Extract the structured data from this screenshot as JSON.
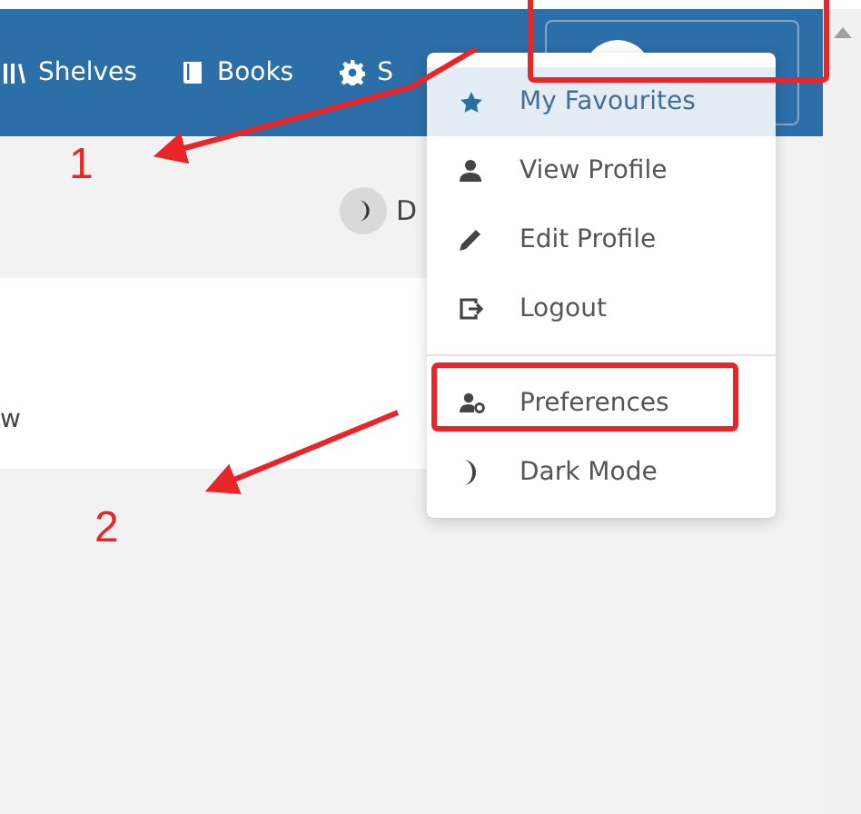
{
  "nav": [
    {
      "label": "Shelves"
    },
    {
      "label": "Books"
    },
    {
      "label": "S"
    }
  ],
  "theme_toggle": {
    "label": "D"
  },
  "card": {
    "text": "w"
  },
  "menu": {
    "sections": [
      {
        "items": [
          {
            "label": "My Favourites",
            "selected": true
          },
          {
            "label": "View Profile",
            "selected": false
          },
          {
            "label": "Edit Profile",
            "selected": false
          },
          {
            "label": "Logout",
            "selected": false
          }
        ]
      },
      {
        "items": [
          {
            "label": "Preferences",
            "selected": false
          },
          {
            "label": "Dark Mode",
            "selected": false
          }
        ]
      }
    ]
  },
  "annotations": [
    {
      "number": "1"
    },
    {
      "number": "2"
    }
  ]
}
